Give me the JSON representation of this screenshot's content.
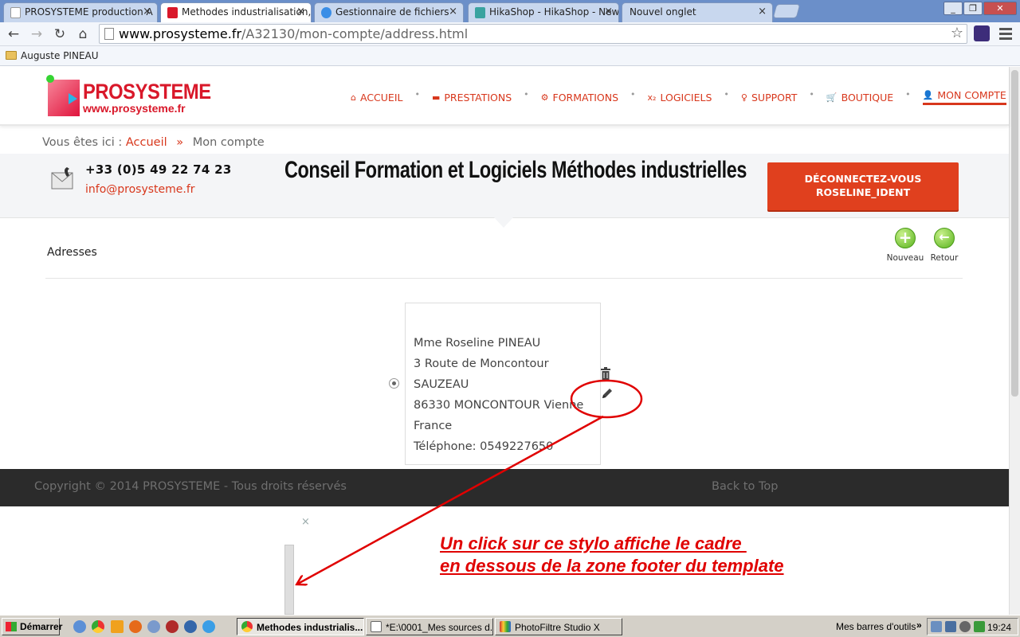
{
  "browser": {
    "tabs": [
      {
        "title": "PROSYSTEME production A",
        "active": false,
        "icon": "page-icon"
      },
      {
        "title": "Methodes industrialisation, Ar",
        "active": true,
        "icon": "prosysteme-favicon"
      },
      {
        "title": "Gestionnaire de fichiers",
        "active": false,
        "icon": "file-manager-icon"
      },
      {
        "title": "HikaShop - HikaShop - New",
        "active": false,
        "icon": "hikashop-icon"
      },
      {
        "title": "Nouvel onglet",
        "active": false,
        "icon": ""
      }
    ],
    "address_host": "www.prosysteme.fr",
    "address_path": "/A32130/mon-compte/address.html",
    "bookmark": "Auguste PINEAU",
    "close_glyph": "×"
  },
  "header": {
    "brand": "PROSYSTEME",
    "brand_url": "www.prosysteme.fr",
    "nav": [
      {
        "label": "ACCUEIL",
        "icon": "home-icon",
        "glyph": "⌂"
      },
      {
        "label": "PRESTATIONS",
        "icon": "list-icon",
        "glyph": "▬"
      },
      {
        "label": "FORMATIONS",
        "icon": "gears-icon",
        "glyph": "⚙"
      },
      {
        "label": "LOGICIELS",
        "icon": "subscript-icon",
        "glyph": "x₂"
      },
      {
        "label": "SUPPORT",
        "icon": "lightbulb-icon",
        "glyph": "♀"
      },
      {
        "label": "BOUTIQUE",
        "icon": "cart-icon",
        "glyph": "🛒"
      },
      {
        "label": "MON COMPTE",
        "icon": "user-icon",
        "glyph": "👤",
        "active": true
      }
    ],
    "nav_separator": "•",
    "accent": "#d8371c"
  },
  "breadcrumb": {
    "prefix": "Vous êtes ici :",
    "home": "Accueil",
    "separator": "»",
    "current": "Mon compte"
  },
  "banner": {
    "phone": "+33 (0)5 49 22 74 23",
    "email": "info@prosysteme.fr",
    "tagline": "Conseil Formation et Logiciels Méthodes industrielles",
    "logout_line1": "DÉCONNECTEZ-VOUS",
    "logout_line2": "ROSELINE_IDENT"
  },
  "addresses": {
    "title": "Adresses",
    "new_label": "Nouveau",
    "back_label": "Retour",
    "new_glyph": "+",
    "back_glyph": "←",
    "address_lines": [
      "Mme Roseline PINEAU",
      "3 Route de Moncontour",
      "SAUZEAU",
      "86330 MONCONTOUR Vienne",
      "France",
      "Téléphone: 0549227650"
    ]
  },
  "footer": {
    "copyright": "Copyright © 2014 PROSYSTEME - Tous droits réservés",
    "back_to_top": "Back to Top"
  },
  "annotation": {
    "line1": "Un click sur ce stylo affiche le cadre ",
    "line2": "en dessous de la zone footer du template",
    "color": "#e00000"
  },
  "panel": {
    "close_glyph": "×"
  },
  "taskbar": {
    "start": "Démarrer",
    "tasks": [
      {
        "label": "Methodes industrialis...",
        "active": true,
        "icon": "chrome-icon"
      },
      {
        "label": "*E:\\0001_Mes sources d...",
        "active": false,
        "icon": "notepad-icon"
      },
      {
        "label": "PhotoFiltre Studio X",
        "active": false,
        "icon": "photofiltre-icon"
      }
    ],
    "toolbars_label": "Mes barres d'outils",
    "tray_arrow": "»",
    "clock": "19:24"
  }
}
